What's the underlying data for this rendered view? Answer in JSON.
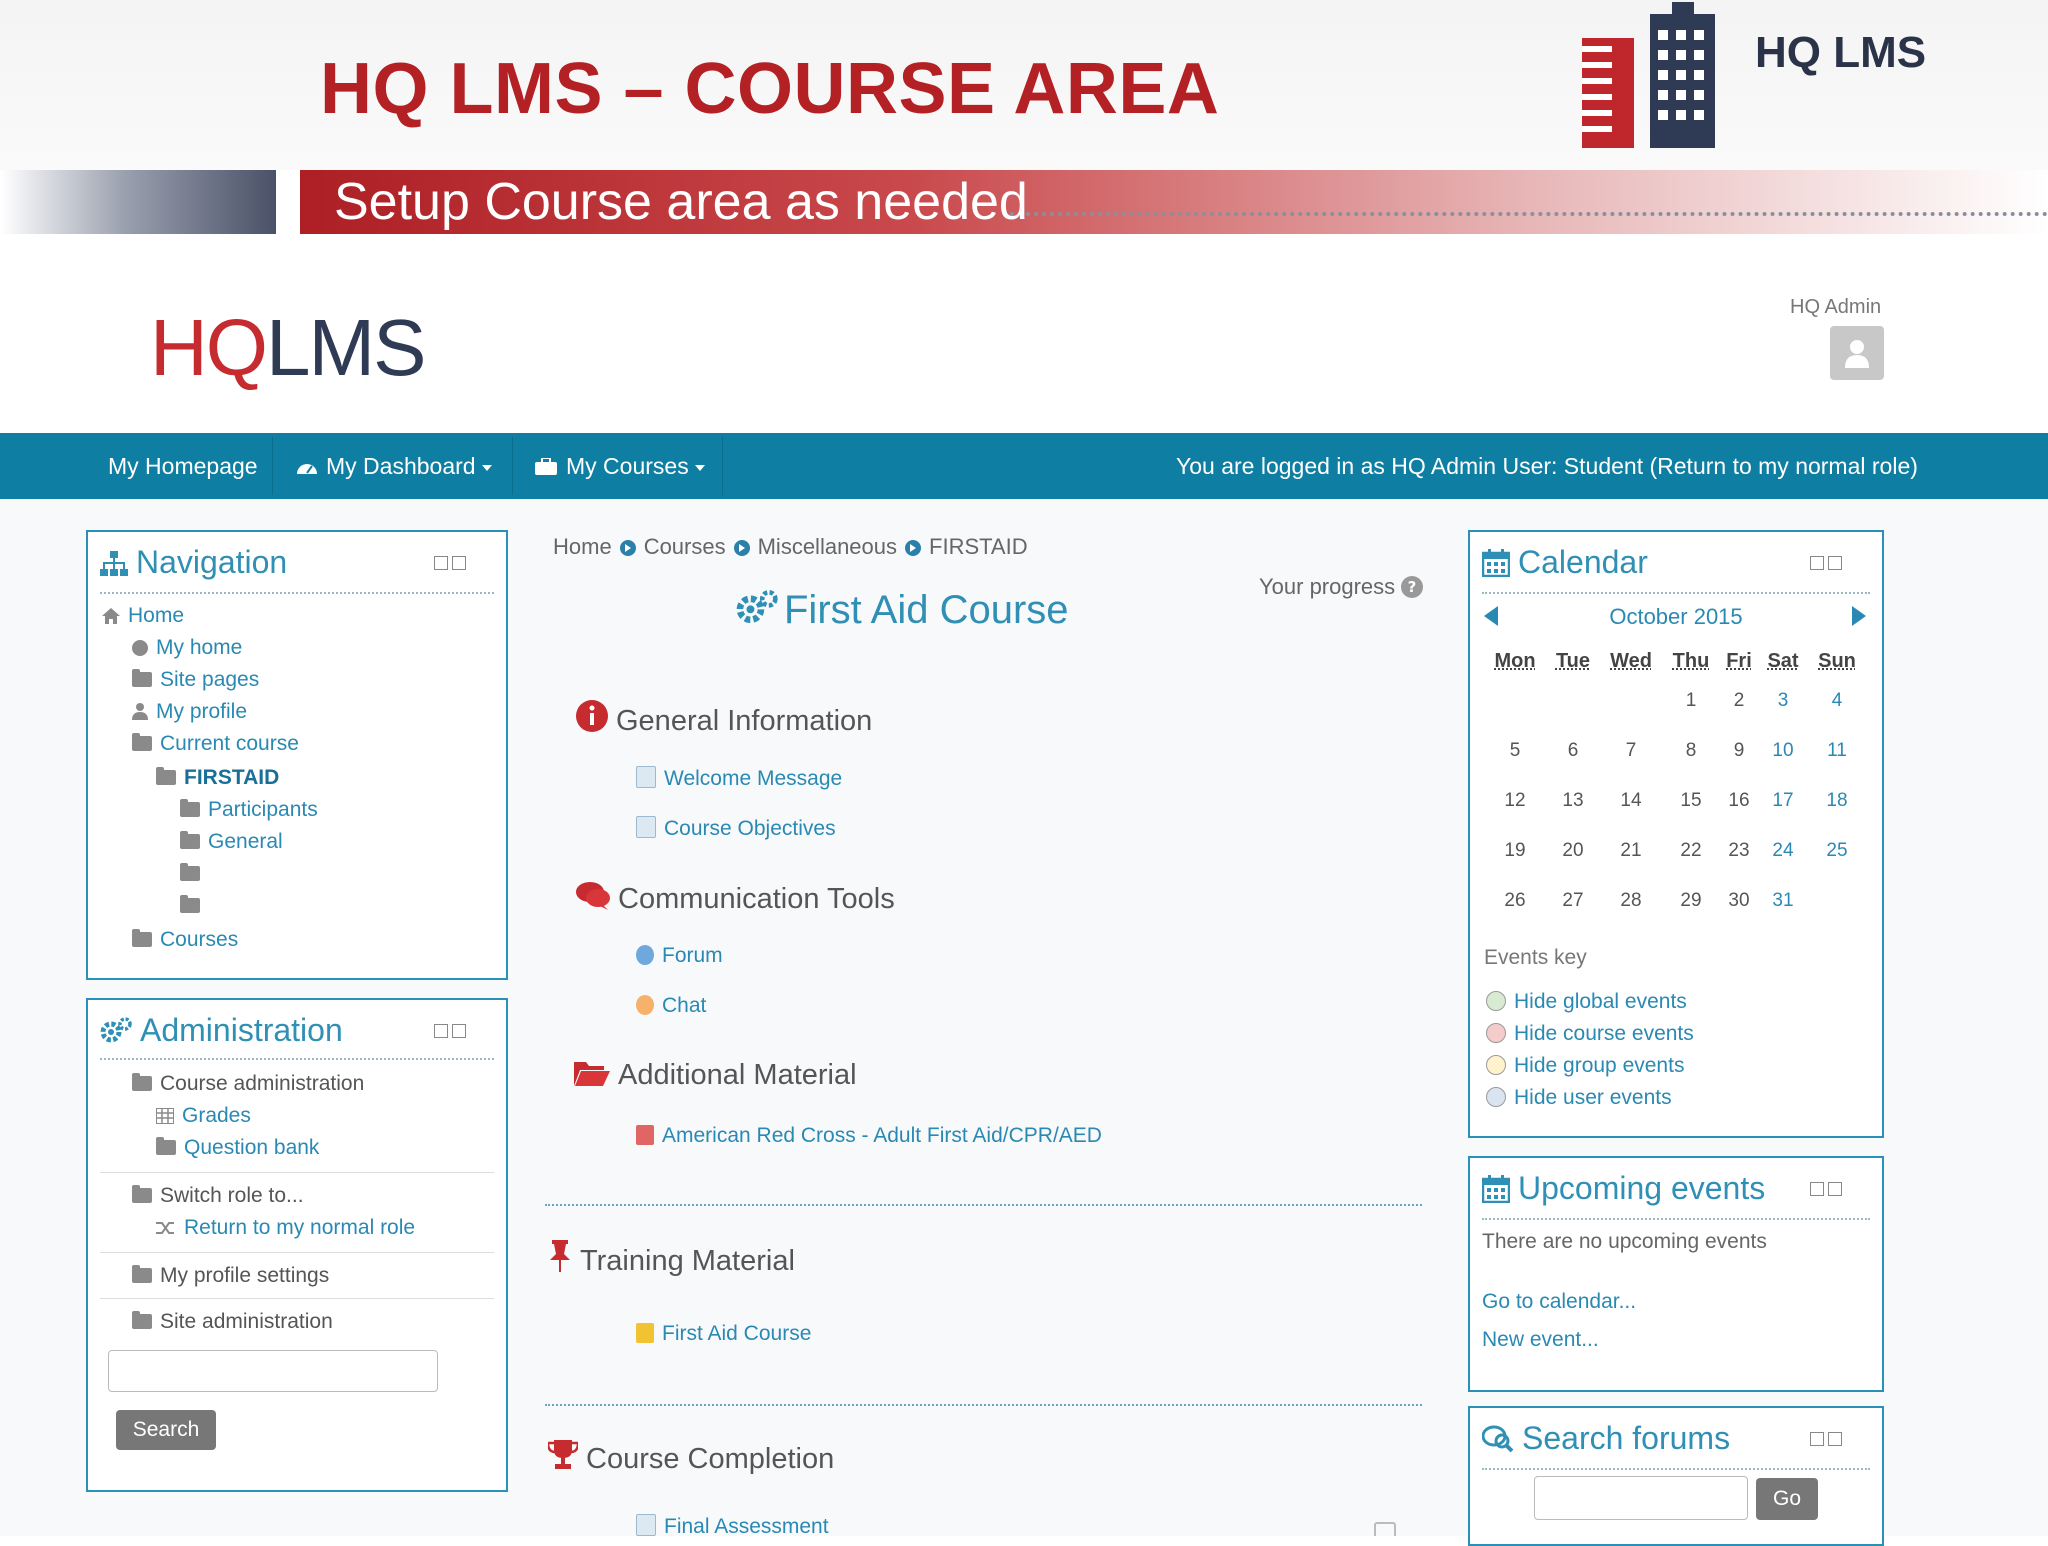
{
  "slide": {
    "title": "HQ LMS – COURSE AREA",
    "brand": "HQ LMS",
    "subtitle": "Setup Course area as needed"
  },
  "lms": {
    "logo_hq": "HQ",
    "logo_lms": "LMS",
    "user_name": "HQ Admin"
  },
  "navbar": {
    "homepage": "My Homepage",
    "dashboard": "My Dashboard",
    "courses": "My Courses",
    "login_status": "You are logged in as HQ Admin User: Student (Return to my normal role)"
  },
  "navigation": {
    "title": "Navigation",
    "home": "Home",
    "my_home": "My home",
    "site_pages": "Site pages",
    "my_profile": "My profile",
    "current_course": "Current course",
    "firstaid": "FIRSTAID",
    "participants": "Participants",
    "general": "General",
    "courses": "Courses"
  },
  "administration": {
    "title": "Administration",
    "course_admin": "Course administration",
    "grades": "Grades",
    "question_bank": "Question bank",
    "switch_role": "Switch role to...",
    "return_role": "Return to my normal role",
    "profile_settings": "My profile settings",
    "site_admin": "Site administration",
    "search_button": "Search"
  },
  "breadcrumb": [
    "Home",
    "Courses",
    "Miscellaneous",
    "FIRSTAID"
  ],
  "course": {
    "progress_label": "Your progress",
    "title": "First Aid Course",
    "sections": [
      {
        "title": "General Information",
        "items": [
          "Welcome Message",
          "Course Objectives"
        ]
      },
      {
        "title": "Communication Tools",
        "items": [
          "Forum",
          "Chat"
        ]
      },
      {
        "title": "Additional Material",
        "items": [
          "American Red Cross - Adult First Aid/CPR/AED"
        ]
      },
      {
        "title": "Training Material",
        "items": [
          "First Aid Course"
        ]
      },
      {
        "title": "Course Completion",
        "items": [
          "Final Assessment"
        ]
      }
    ]
  },
  "calendar": {
    "title": "Calendar",
    "month": "October 2015",
    "days": [
      "Mon",
      "Tue",
      "Wed",
      "Thu",
      "Fri",
      "Sat",
      "Sun"
    ],
    "weeks": [
      [
        "",
        "",
        "",
        "1",
        "2",
        "3",
        "4"
      ],
      [
        "5",
        "6",
        "7",
        "8",
        "9",
        "10",
        "11"
      ],
      [
        "12",
        "13",
        "14",
        "15",
        "16",
        "17",
        "18"
      ],
      [
        "19",
        "20",
        "21",
        "22",
        "23",
        "24",
        "25"
      ],
      [
        "26",
        "27",
        "28",
        "29",
        "30",
        "31",
        ""
      ]
    ],
    "events_key": "Events key",
    "keys": [
      "Hide global events",
      "Hide course events",
      "Hide group events",
      "Hide user events"
    ],
    "key_colors": [
      "#d9ead3",
      "#f4cccc",
      "#fff2cc",
      "#d9e4f0"
    ]
  },
  "upcoming": {
    "title": "Upcoming events",
    "none": "There are no upcoming events",
    "go_calendar": "Go to calendar...",
    "new_event": "New event..."
  },
  "search_forums": {
    "title": "Search forums",
    "go": "Go"
  },
  "colors": {
    "accent": "#0e7fa2",
    "brand_red": "#b32124",
    "link": "#2a89b3"
  }
}
